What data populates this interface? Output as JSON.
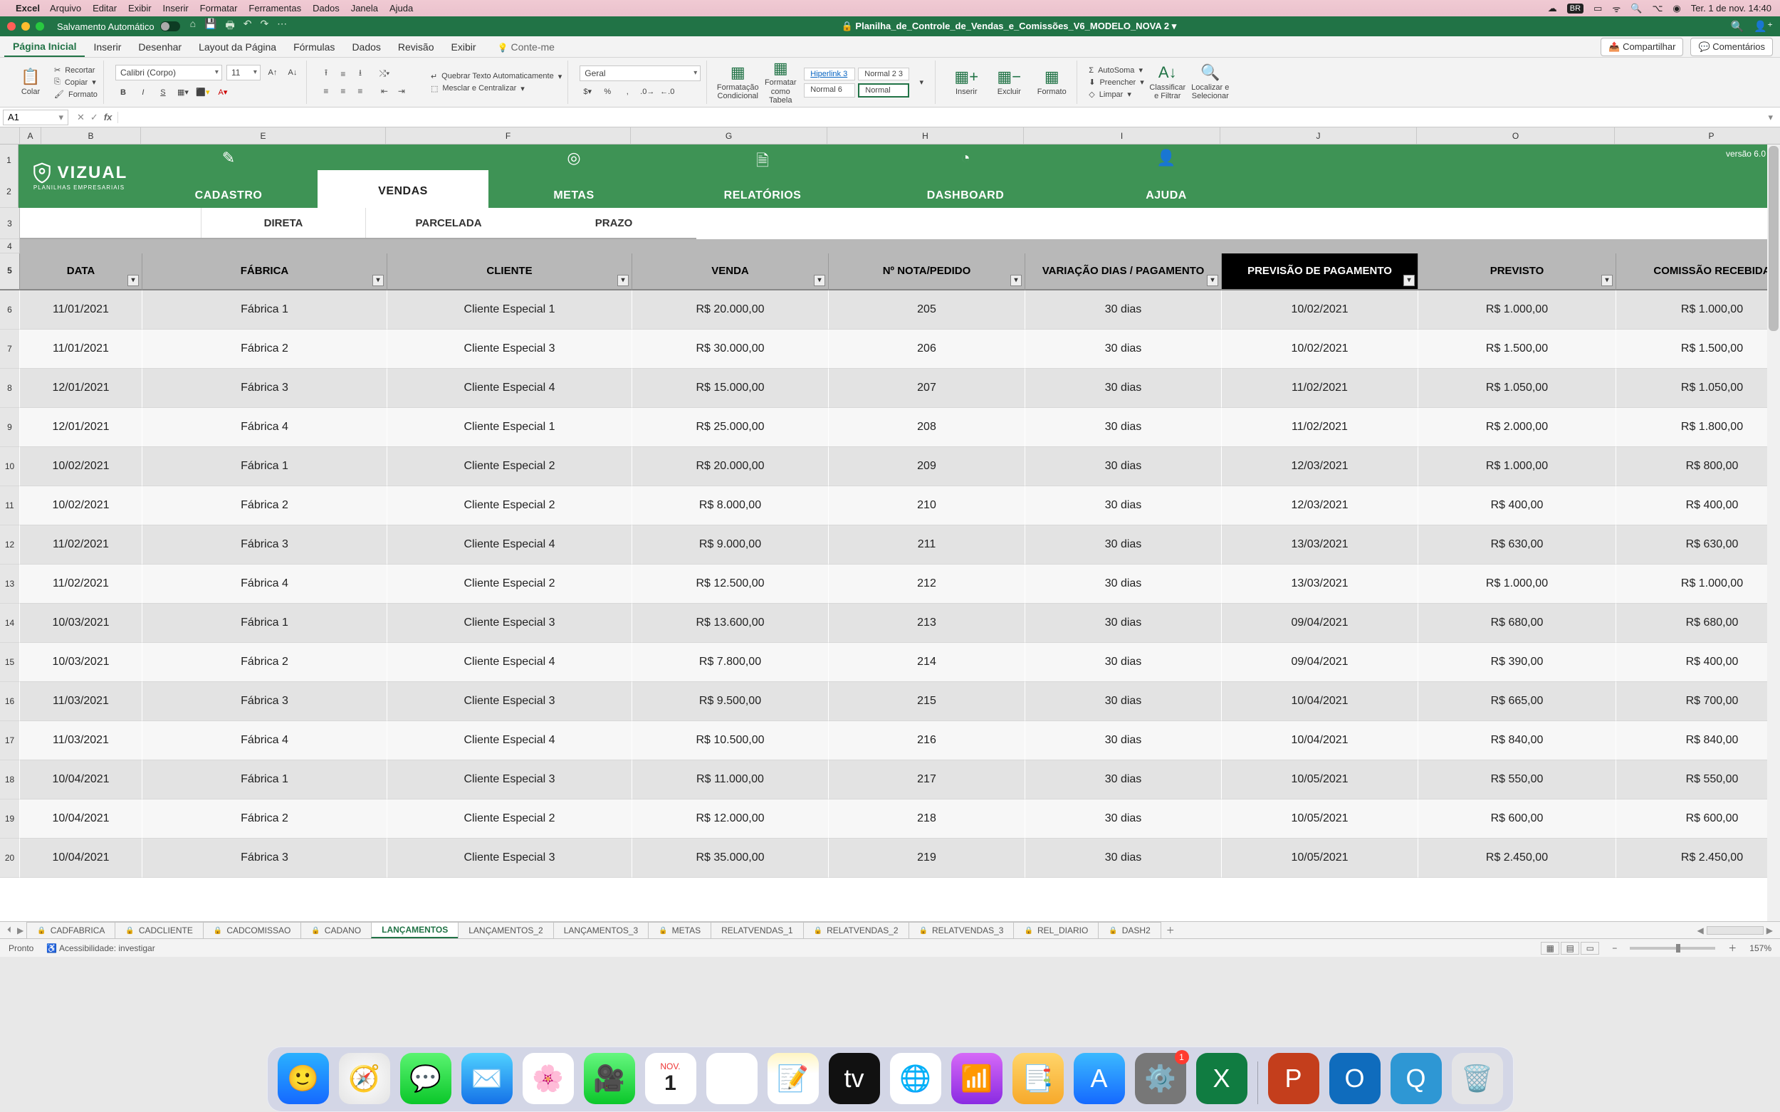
{
  "mac_menu": {
    "app": "Excel",
    "items": [
      "Arquivo",
      "Editar",
      "Exibir",
      "Inserir",
      "Formatar",
      "Ferramentas",
      "Dados",
      "Janela",
      "Ajuda"
    ],
    "input_lang": "BR",
    "clock": "Ter. 1 de nov.  14:40"
  },
  "titlebar": {
    "autosave_label": "Salvamento Automático",
    "doc_title": "Planilha_de_Controle_de_Vendas_e_Comissões_V6_MODELO_NOVA 2"
  },
  "ribbon_tabs": {
    "items": [
      "Página Inicial",
      "Inserir",
      "Desenhar",
      "Layout da Página",
      "Fórmulas",
      "Dados",
      "Revisão",
      "Exibir"
    ],
    "tell_me": "Conte-me",
    "share": "Compartilhar",
    "comments": "Comentários"
  },
  "ribbon": {
    "paste": "Colar",
    "clip": {
      "cut": "Recortar",
      "copy": "Copiar",
      "format": "Formato"
    },
    "font_name": "Calibri (Corpo)",
    "font_size": "11",
    "wrap": "Quebrar Texto Automaticamente",
    "merge": "Mesclar e Centralizar",
    "num_format": "Geral",
    "cond": "Formatação Condicional",
    "as_table": "Formatar como Tabela",
    "styles": {
      "hiperlink": "Hiperlink 3",
      "normal23": "Normal 2 3",
      "normal6": "Normal 6",
      "normal": "Normal"
    },
    "insert": "Inserir",
    "delete": "Excluir",
    "format_cell": "Formato",
    "autosum": "AutoSoma",
    "fill": "Preencher",
    "clear": "Limpar",
    "sort": "Classificar e Filtrar",
    "find": "Localizar e Selecionar"
  },
  "formula": {
    "cell_ref": "A1",
    "formula": ""
  },
  "col_headers": [
    "A",
    "B",
    "E",
    "F",
    "G",
    "H",
    "I",
    "J",
    "O",
    "P"
  ],
  "nav": {
    "brand": "VIZUAL",
    "brand_sub": "PLANILHAS EMPRESARIAIS",
    "version": "versão 6.0",
    "tabs": [
      "CADASTRO",
      "VENDAS",
      "METAS",
      "RELATÓRIOS",
      "DASHBOARD",
      "AJUDA"
    ],
    "subtabs": [
      "DIRETA",
      "PARCELADA",
      "PRAZO"
    ]
  },
  "table": {
    "headers": [
      "DATA",
      "FÁBRICA",
      "CLIENTE",
      "VENDA",
      "Nº NOTA/PEDIDO",
      "VARIAÇÃO DIAS / PAGAMENTO",
      "PREVISÃO DE PAGAMENTO",
      "PREVISTO",
      "COMISSÃO RECEBIDA"
    ],
    "rows": [
      {
        "data": "11/01/2021",
        "fab": "Fábrica 1",
        "cli": "Cliente Especial 1",
        "venda": "R$ 20.000,00",
        "nota": "205",
        "var": "30 dias",
        "prev": "10/02/2021",
        "previsto": "R$ 1.000,00",
        "com": "R$ 1.000,00"
      },
      {
        "data": "11/01/2021",
        "fab": "Fábrica 2",
        "cli": "Cliente Especial 3",
        "venda": "R$ 30.000,00",
        "nota": "206",
        "var": "30 dias",
        "prev": "10/02/2021",
        "previsto": "R$ 1.500,00",
        "com": "R$ 1.500,00"
      },
      {
        "data": "12/01/2021",
        "fab": "Fábrica 3",
        "cli": "Cliente Especial 4",
        "venda": "R$ 15.000,00",
        "nota": "207",
        "var": "30 dias",
        "prev": "11/02/2021",
        "previsto": "R$ 1.050,00",
        "com": "R$ 1.050,00"
      },
      {
        "data": "12/01/2021",
        "fab": "Fábrica 4",
        "cli": "Cliente Especial 1",
        "venda": "R$ 25.000,00",
        "nota": "208",
        "var": "30 dias",
        "prev": "11/02/2021",
        "previsto": "R$ 2.000,00",
        "com": "R$ 1.800,00"
      },
      {
        "data": "10/02/2021",
        "fab": "Fábrica 1",
        "cli": "Cliente Especial 2",
        "venda": "R$ 20.000,00",
        "nota": "209",
        "var": "30 dias",
        "prev": "12/03/2021",
        "previsto": "R$ 1.000,00",
        "com": "R$ 800,00"
      },
      {
        "data": "10/02/2021",
        "fab": "Fábrica 2",
        "cli": "Cliente Especial 2",
        "venda": "R$ 8.000,00",
        "nota": "210",
        "var": "30 dias",
        "prev": "12/03/2021",
        "previsto": "R$ 400,00",
        "com": "R$ 400,00"
      },
      {
        "data": "11/02/2021",
        "fab": "Fábrica 3",
        "cli": "Cliente Especial 4",
        "venda": "R$ 9.000,00",
        "nota": "211",
        "var": "30 dias",
        "prev": "13/03/2021",
        "previsto": "R$ 630,00",
        "com": "R$ 630,00"
      },
      {
        "data": "11/02/2021",
        "fab": "Fábrica 4",
        "cli": "Cliente Especial 2",
        "venda": "R$ 12.500,00",
        "nota": "212",
        "var": "30 dias",
        "prev": "13/03/2021",
        "previsto": "R$ 1.000,00",
        "com": "R$ 1.000,00"
      },
      {
        "data": "10/03/2021",
        "fab": "Fábrica 1",
        "cli": "Cliente Especial 3",
        "venda": "R$ 13.600,00",
        "nota": "213",
        "var": "30 dias",
        "prev": "09/04/2021",
        "previsto": "R$ 680,00",
        "com": "R$ 680,00"
      },
      {
        "data": "10/03/2021",
        "fab": "Fábrica 2",
        "cli": "Cliente Especial 4",
        "venda": "R$ 7.800,00",
        "nota": "214",
        "var": "30 dias",
        "prev": "09/04/2021",
        "previsto": "R$ 390,00",
        "com": "R$ 400,00"
      },
      {
        "data": "11/03/2021",
        "fab": "Fábrica 3",
        "cli": "Cliente Especial 3",
        "venda": "R$ 9.500,00",
        "nota": "215",
        "var": "30 dias",
        "prev": "10/04/2021",
        "previsto": "R$ 665,00",
        "com": "R$ 700,00"
      },
      {
        "data": "11/03/2021",
        "fab": "Fábrica 4",
        "cli": "Cliente Especial 4",
        "venda": "R$ 10.500,00",
        "nota": "216",
        "var": "30 dias",
        "prev": "10/04/2021",
        "previsto": "R$ 840,00",
        "com": "R$ 840,00"
      },
      {
        "data": "10/04/2021",
        "fab": "Fábrica 1",
        "cli": "Cliente Especial 3",
        "venda": "R$ 11.000,00",
        "nota": "217",
        "var": "30 dias",
        "prev": "10/05/2021",
        "previsto": "R$ 550,00",
        "com": "R$ 550,00"
      },
      {
        "data": "10/04/2021",
        "fab": "Fábrica 2",
        "cli": "Cliente Especial 2",
        "venda": "R$ 12.000,00",
        "nota": "218",
        "var": "30 dias",
        "prev": "10/05/2021",
        "previsto": "R$ 600,00",
        "com": "R$ 600,00"
      },
      {
        "data": "10/04/2021",
        "fab": "Fábrica 3",
        "cli": "Cliente Especial 3",
        "venda": "R$ 35.000,00",
        "nota": "219",
        "var": "30 dias",
        "prev": "10/05/2021",
        "previsto": "R$ 2.450,00",
        "com": "R$ 2.450,00"
      }
    ]
  },
  "sheets": {
    "tabs": [
      {
        "name": "CADFABRICA",
        "locked": true
      },
      {
        "name": "CADCLIENTE",
        "locked": true
      },
      {
        "name": "CADCOMISSAO",
        "locked": true
      },
      {
        "name": "CADANO",
        "locked": true
      },
      {
        "name": "LANÇAMENTOS",
        "locked": false,
        "active": true
      },
      {
        "name": "LANÇAMENTOS_2",
        "locked": false
      },
      {
        "name": "LANÇAMENTOS_3",
        "locked": false
      },
      {
        "name": "METAS",
        "locked": true
      },
      {
        "name": "RELATVENDAS_1",
        "locked": false
      },
      {
        "name": "RELATVENDAS_2",
        "locked": true
      },
      {
        "name": "RELATVENDAS_3",
        "locked": true
      },
      {
        "name": "REL_DIARIO",
        "locked": true
      },
      {
        "name": "DASH2",
        "locked": true
      }
    ]
  },
  "status": {
    "ready": "Pronto",
    "access": "Acessibilidade: investigar",
    "zoom": "157%"
  },
  "dock": {
    "calendar": {
      "month": "NOV.",
      "day": "1"
    },
    "settings_badge": "1"
  }
}
